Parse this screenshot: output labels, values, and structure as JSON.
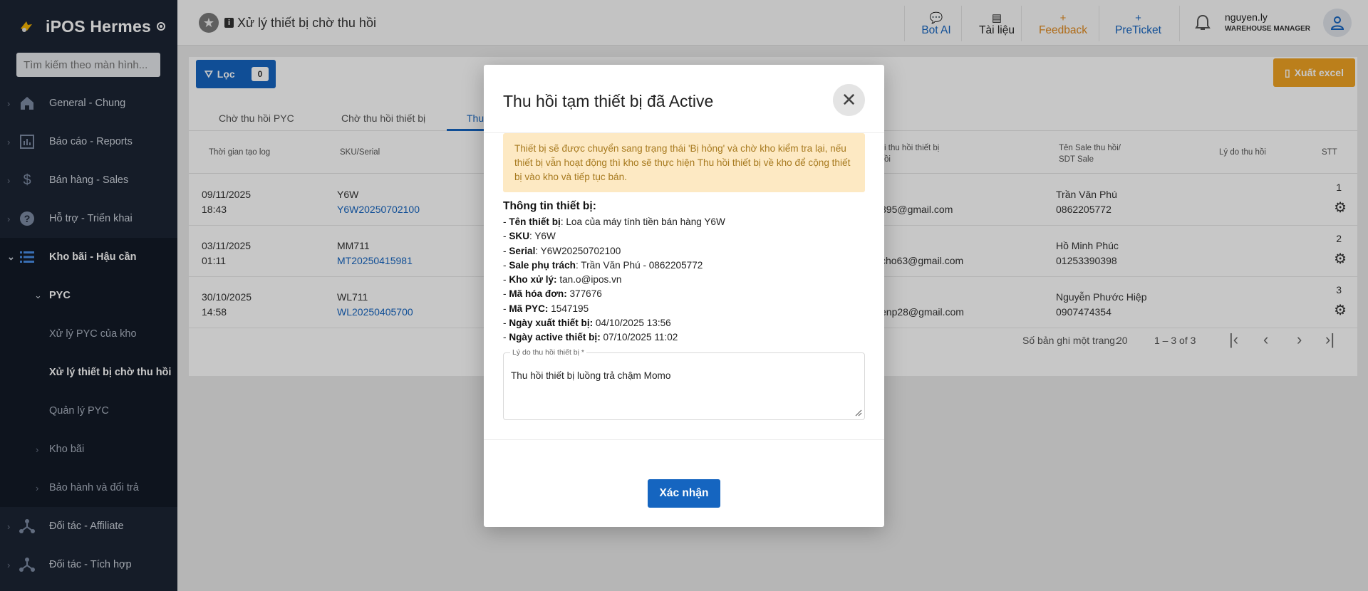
{
  "sidebar": {
    "brand": "iPOS Hermes",
    "search_placeholder": "Tìm kiếm theo màn hình...",
    "items": [
      {
        "label": "General - Chung",
        "icon": "home-icon"
      },
      {
        "label": "Báo cáo - Reports",
        "icon": "chart-icon"
      },
      {
        "label": "Bán hàng - Sales",
        "icon": "dollar-icon"
      },
      {
        "label": "Hỗ trợ - Triển khai",
        "icon": "help-icon"
      },
      {
        "label": "Kho bãi - Hậu cần",
        "icon": "list-icon"
      },
      {
        "label": "PYC"
      },
      {
        "label": "Xử lý PYC của kho"
      },
      {
        "label": "Xử lý thiết bị chờ thu hồi"
      },
      {
        "label": "Quản lý PYC"
      },
      {
        "label": "Kho bãi"
      },
      {
        "label": "Bảo hành và đổi trả"
      },
      {
        "label": "Đối tác - Affiliate",
        "icon": "network-icon"
      },
      {
        "label": "Đối tác - Tích hợp",
        "icon": "network-icon"
      }
    ]
  },
  "topbar": {
    "title": "Xử lý thiết bị chờ thu hồi",
    "buttons": [
      {
        "label": "Bot AI",
        "icon": "chat-icon",
        "color": "#1565c0"
      },
      {
        "label": "Tài liệu",
        "icon": "book-icon",
        "color": "#222222"
      },
      {
        "label": "Feedback",
        "icon": "plus-icon",
        "color": "#e08a1e"
      },
      {
        "label": "PreTicket",
        "icon": "plus-icon",
        "color": "#1565c0"
      }
    ],
    "user_name": "nguyen.ly",
    "user_role": "WAREHOUSE MANAGER"
  },
  "content": {
    "filter_label": "Lọc",
    "filter_count": "0",
    "export_label": "Xuất excel",
    "tabs": [
      "Chờ thu hồi PYC",
      "Chờ thu hồi thiết bị",
      "Thu"
    ],
    "headers": {
      "time": "Thời gian tạo log",
      "sku": "SKU/Serial",
      "recall": "i thu hồi thiết bị",
      "recall2": "ồi",
      "sale": "Tên Sale thu hồi/",
      "sale2": "SDT Sale",
      "reason": "Lý do thu hồi",
      "stt": "STT"
    },
    "rows": [
      {
        "date": "09/11/2025",
        "time": "18:43",
        "sku": "Y6W",
        "serial": "Y6W20250702100",
        "email": "395@gmail.com",
        "sale": "Trần Văn Phú",
        "phone": "0862205772",
        "stt": "1"
      },
      {
        "date": "03/11/2025",
        "time": "01:11",
        "sku": "MM711",
        "serial": "MT20250415981",
        "email": "cho63@gmail.com",
        "sale": "Hồ Minh Phúc",
        "phone": "01253390398",
        "stt": "2"
      },
      {
        "date": "30/10/2025",
        "time": "14:58",
        "sku": "WL711",
        "serial": "WL20250405700",
        "email": "enp28@gmail.com",
        "sale": "Nguyễn Phước Hiệp",
        "phone": "0907474354",
        "stt": "3"
      }
    ],
    "rows_per_page_label": "Số bản ghi một trang:",
    "rows_per_page": "20",
    "range": "1 – 3 of 3"
  },
  "modal": {
    "title": "Thu hồi tạm thiết bị đã Active",
    "warning": "Thiết bị sẽ được chuyển sang trạng thái 'Bị hỏng' và chờ kho kiểm tra lại, nếu thiết bị vẫn hoạt động thì kho sẽ thực hiện Thu hồi thiết bị về kho để cộng thiết bị vào kho và tiếp tục bán.",
    "info_title": "Thông tin thiết bị:",
    "lines": [
      {
        "label": "Tên thiết bị",
        "value": ": Loa của máy tính tiền bán hàng Y6W"
      },
      {
        "label": "SKU",
        "value": ": Y6W"
      },
      {
        "label": "Serial",
        "value": ": Y6W20250702100"
      },
      {
        "label": "Sale phụ trách",
        "value": ": Trần Văn Phú - 0862205772"
      },
      {
        "label": "Kho xử lý:",
        "value": " tan.o@ipos.vn"
      },
      {
        "label": "Mã hóa đơn:",
        "value": " 377676"
      },
      {
        "label": "Mã PYC:",
        "value": " 1547195"
      },
      {
        "label": "Ngày xuất thiết bị:",
        "value": " 04/10/2025 13:56"
      },
      {
        "label": "Ngày active thiết bị:",
        "value": " 07/10/2025 11:02"
      }
    ],
    "field_label": "Lý do thu hồi thiết bị *",
    "field_value": "Thu hồi thiết bị luồng trả chậm Momo",
    "confirm_label": "Xác nhận"
  }
}
